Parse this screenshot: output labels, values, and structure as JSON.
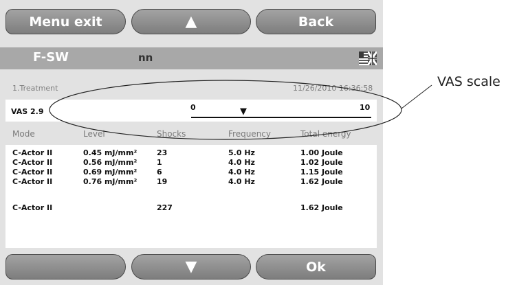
{
  "top_buttons": {
    "menu_exit": "Menu exit",
    "up": "▲",
    "back": "Back"
  },
  "header": {
    "mode": "F-SW",
    "patient": "nn"
  },
  "treatment": {
    "title": "1.Treatment",
    "datetime": "11/26/2010 16:36:58"
  },
  "vas": {
    "label": "VAS 2.9",
    "min": "0",
    "max": "10",
    "value": 2.9
  },
  "table": {
    "columns": [
      "Mode",
      "Level",
      "Shocks",
      "Frequency",
      "Total energy"
    ],
    "rows": [
      [
        "C-Actor II",
        "0.45 mJ/mm²",
        "23",
        "5.0 Hz",
        "1.00 Joule"
      ],
      [
        "C-Actor II",
        "0.56 mJ/mm²",
        "1",
        "4.0 Hz",
        "1.02 Joule"
      ],
      [
        "C-Actor II",
        "0.69 mJ/mm²",
        "6",
        "4.0 Hz",
        "1.15 Joule"
      ],
      [
        "C-Actor II",
        "0.76 mJ/mm²",
        "19",
        "4.0 Hz",
        "1.62 Joule"
      ]
    ],
    "total": [
      "C-Actor II",
      "",
      "227",
      "",
      "1.62 Joule"
    ]
  },
  "bottom_buttons": {
    "left": "",
    "down": "▼",
    "ok": "Ok"
  },
  "annotation": "VAS scale"
}
